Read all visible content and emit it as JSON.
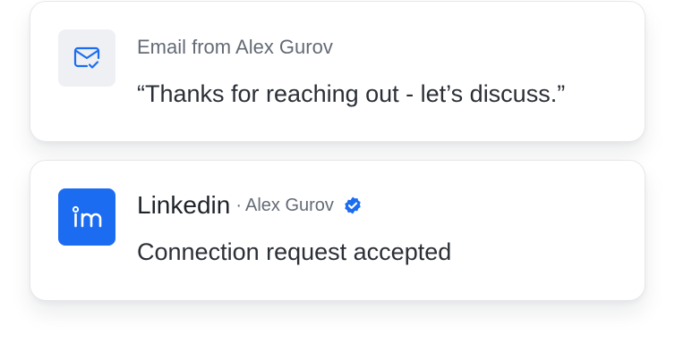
{
  "email_card": {
    "icon": "mail-check-icon",
    "meta": "Email from Alex Gurov",
    "quote": "“Thanks for reaching out - let’s discuss.”"
  },
  "linkedin_card": {
    "icon": "linkedin-icon",
    "title": "Linkedin",
    "separator": "·",
    "name": "Alex Gurov",
    "verified_icon": "verified-check-icon",
    "body": "Connection request accepted"
  },
  "colors": {
    "brand_blue": "#1b6cf1",
    "text_primary": "#2b2f36",
    "text_secondary": "#646b76",
    "tile_gray": "#eef0f3"
  }
}
